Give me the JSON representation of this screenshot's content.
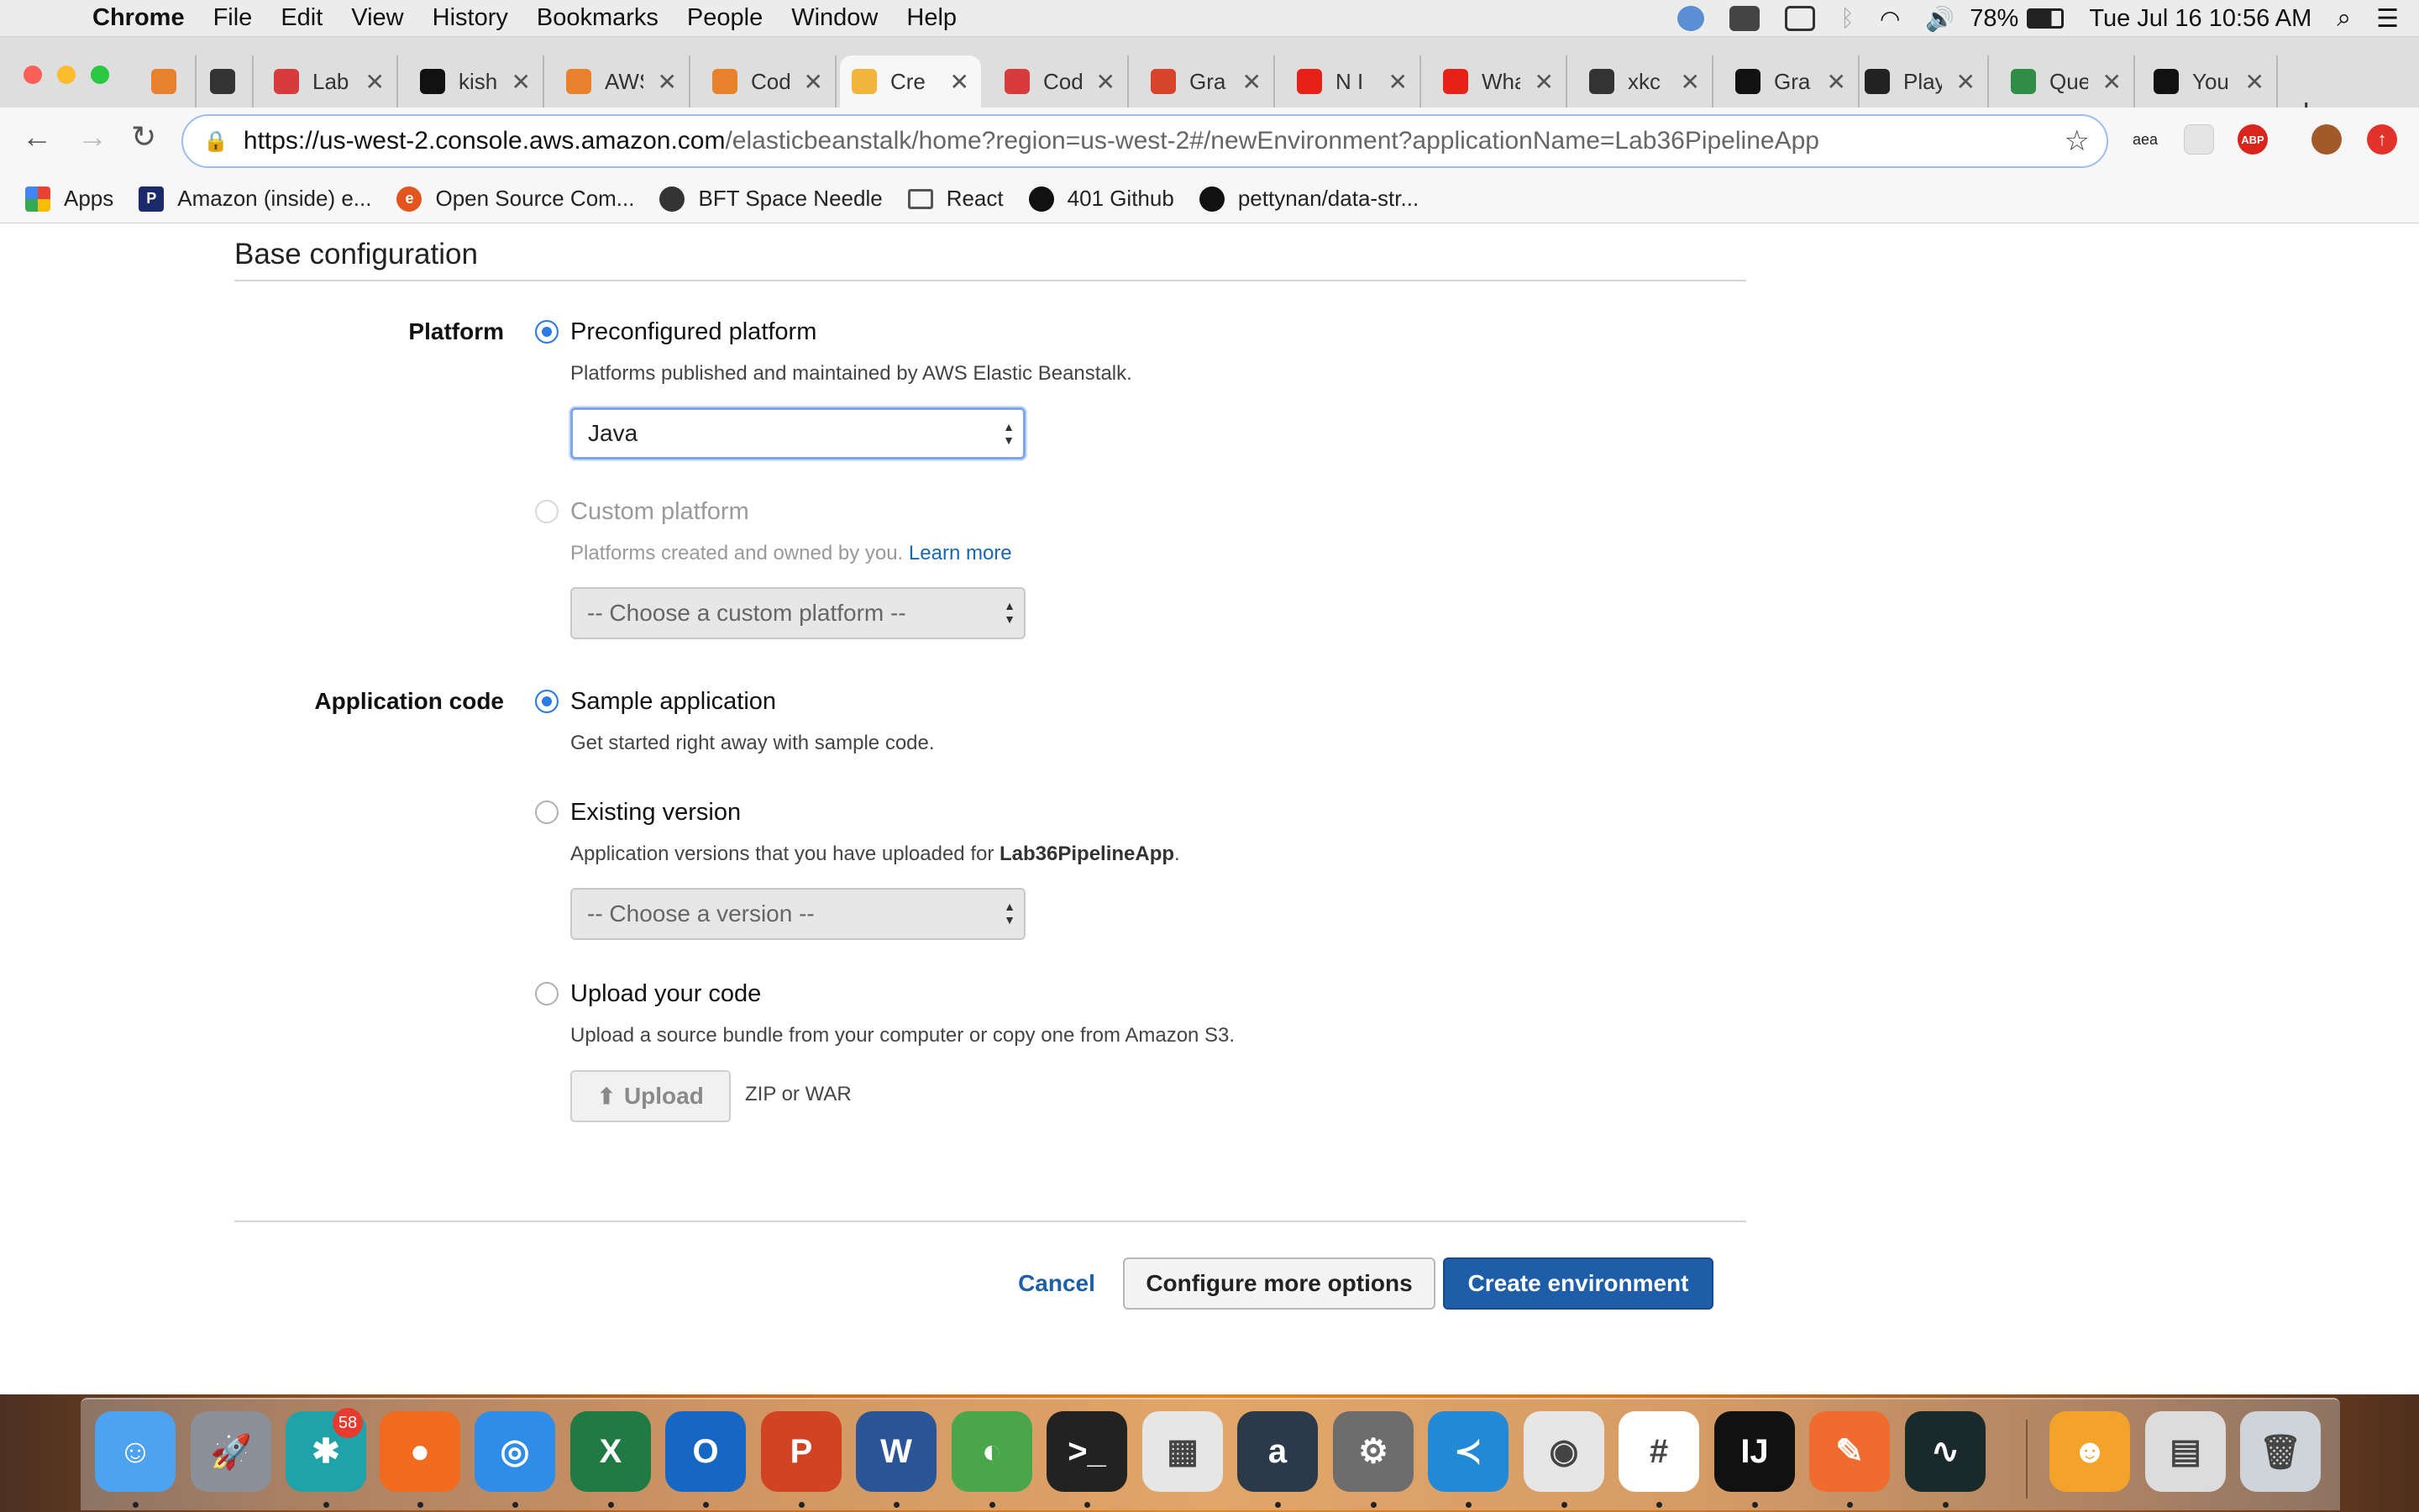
{
  "menubar": {
    "app": "Chrome",
    "items": [
      "File",
      "Edit",
      "View",
      "History",
      "Bookmarks",
      "People",
      "Window",
      "Help"
    ],
    "battery": "78%",
    "clock": "Tue Jul 16  10:56 AM"
  },
  "tabs": [
    {
      "title": "",
      "color": "#e8812b"
    },
    {
      "title": "",
      "color": "#333333"
    },
    {
      "title": "Lab",
      "color": "#d83b3b"
    },
    {
      "title": "kish",
      "color": "#111111"
    },
    {
      "title": "AWS",
      "color": "#e8812b"
    },
    {
      "title": "Cod",
      "color": "#e8812b"
    },
    {
      "title": "Cre",
      "color": "#f2b43c"
    },
    {
      "title": "Cod",
      "color": "#d83b3b"
    },
    {
      "title": "Gra",
      "color": "#d8432c"
    },
    {
      "title": "N I",
      "color": "#e62117"
    },
    {
      "title": "Wha",
      "color": "#e62117"
    },
    {
      "title": "xkc",
      "color": "#333333"
    },
    {
      "title": "Gra",
      "color": "#111111"
    },
    {
      "title": "Play",
      "color": "#222222"
    },
    {
      "title": "Que",
      "color": "#2f8d46"
    },
    {
      "title": "You",
      "color": "#111111"
    }
  ],
  "toolbar": {
    "url_host": "https://us-west-2.console.aws.amazon.com",
    "url_path": "/elasticbeanstalk/home?region=us-west-2#/newEnvironment?applicationName=Lab36PipelineApp",
    "ext_aea": "aea",
    "ext_abp": "ABP"
  },
  "bookmarks": [
    {
      "label": "Apps",
      "icon": "apps-grid-icon"
    },
    {
      "label": "Amazon (inside) e...",
      "icon": "p-icon"
    },
    {
      "label": "Open Source Com...",
      "icon": "e-icon"
    },
    {
      "label": "BFT Space Needle",
      "icon": "globe-icon"
    },
    {
      "label": "React",
      "icon": "folder-icon"
    },
    {
      "label": "401 Github",
      "icon": "github-icon"
    },
    {
      "label": "pettynan/data-str...",
      "icon": "github-icon"
    }
  ],
  "page": {
    "section_title": "Base configuration",
    "platform": {
      "label": "Platform",
      "preconfigured_label": "Preconfigured platform",
      "preconfigured_desc": "Platforms published and maintained by AWS Elastic Beanstalk.",
      "platform_select_value": "Java",
      "custom_label": "Custom platform",
      "custom_desc": "Platforms created and owned by you.",
      "custom_learn_more": "Learn more",
      "custom_select_placeholder": "-- Choose a custom platform --"
    },
    "app_code": {
      "label": "Application code",
      "sample_label": "Sample application",
      "sample_desc": "Get started right away with sample code.",
      "existing_label": "Existing version",
      "existing_desc_prefix": "Application versions that you have uploaded for",
      "existing_desc_app": "Lab36PipelineApp",
      "existing_desc_suffix": ".",
      "existing_select_placeholder": "-- Choose a version --",
      "upload_label": "Upload your code",
      "upload_desc": "Upload a source bundle from your computer or copy one from Amazon S3.",
      "upload_button": "Upload",
      "upload_hint": "ZIP or WAR"
    },
    "footer": {
      "cancel": "Cancel",
      "configure": "Configure more options",
      "create": "Create environment"
    }
  },
  "dock": {
    "badge": "58",
    "apps": [
      {
        "name": "finder",
        "color": "#4da3f0",
        "glyph": "☺"
      },
      {
        "name": "launchpad",
        "color": "#8a8f98",
        "glyph": "🚀"
      },
      {
        "name": "pinwheel",
        "color": "#1fa3a8",
        "glyph": "✱"
      },
      {
        "name": "firefox",
        "color": "#f06b1e",
        "glyph": "●"
      },
      {
        "name": "safari",
        "color": "#2e8de8",
        "glyph": "◎"
      },
      {
        "name": "excel",
        "color": "#1f7a44",
        "glyph": "X"
      },
      {
        "name": "outlook",
        "color": "#1667c4",
        "glyph": "O"
      },
      {
        "name": "powerpoint",
        "color": "#d04423",
        "glyph": "P"
      },
      {
        "name": "word",
        "color": "#2a5699",
        "glyph": "W"
      },
      {
        "name": "network",
        "color": "#4aa64a",
        "glyph": "◐"
      },
      {
        "name": "terminal",
        "color": "#222222",
        "glyph": ">_"
      },
      {
        "name": "squares",
        "color": "#e6e6e6",
        "glyph": "▦"
      },
      {
        "name": "amazon-music",
        "color": "#2a3a4a",
        "glyph": "a"
      },
      {
        "name": "system-preferences",
        "color": "#6d6d6d",
        "glyph": "⚙"
      },
      {
        "name": "vscode",
        "color": "#2389d6",
        "glyph": "≺"
      },
      {
        "name": "chrome",
        "color": "#e6e6e6",
        "glyph": "◉"
      },
      {
        "name": "slack",
        "color": "#ffffff",
        "glyph": "#"
      },
      {
        "name": "intellij",
        "color": "#111111",
        "glyph": "IJ"
      },
      {
        "name": "postman",
        "color": "#f06b2e",
        "glyph": "✎"
      },
      {
        "name": "activity-monitor",
        "color": "#1a2a2a",
        "glyph": "∿"
      },
      {
        "name": "mascot",
        "color": "#f3a32a",
        "glyph": "☻"
      },
      {
        "name": "disk-utility",
        "color": "#dcdcdc",
        "glyph": "▤"
      },
      {
        "name": "trash",
        "color": "#cfd4d8",
        "glyph": "🗑"
      }
    ]
  }
}
